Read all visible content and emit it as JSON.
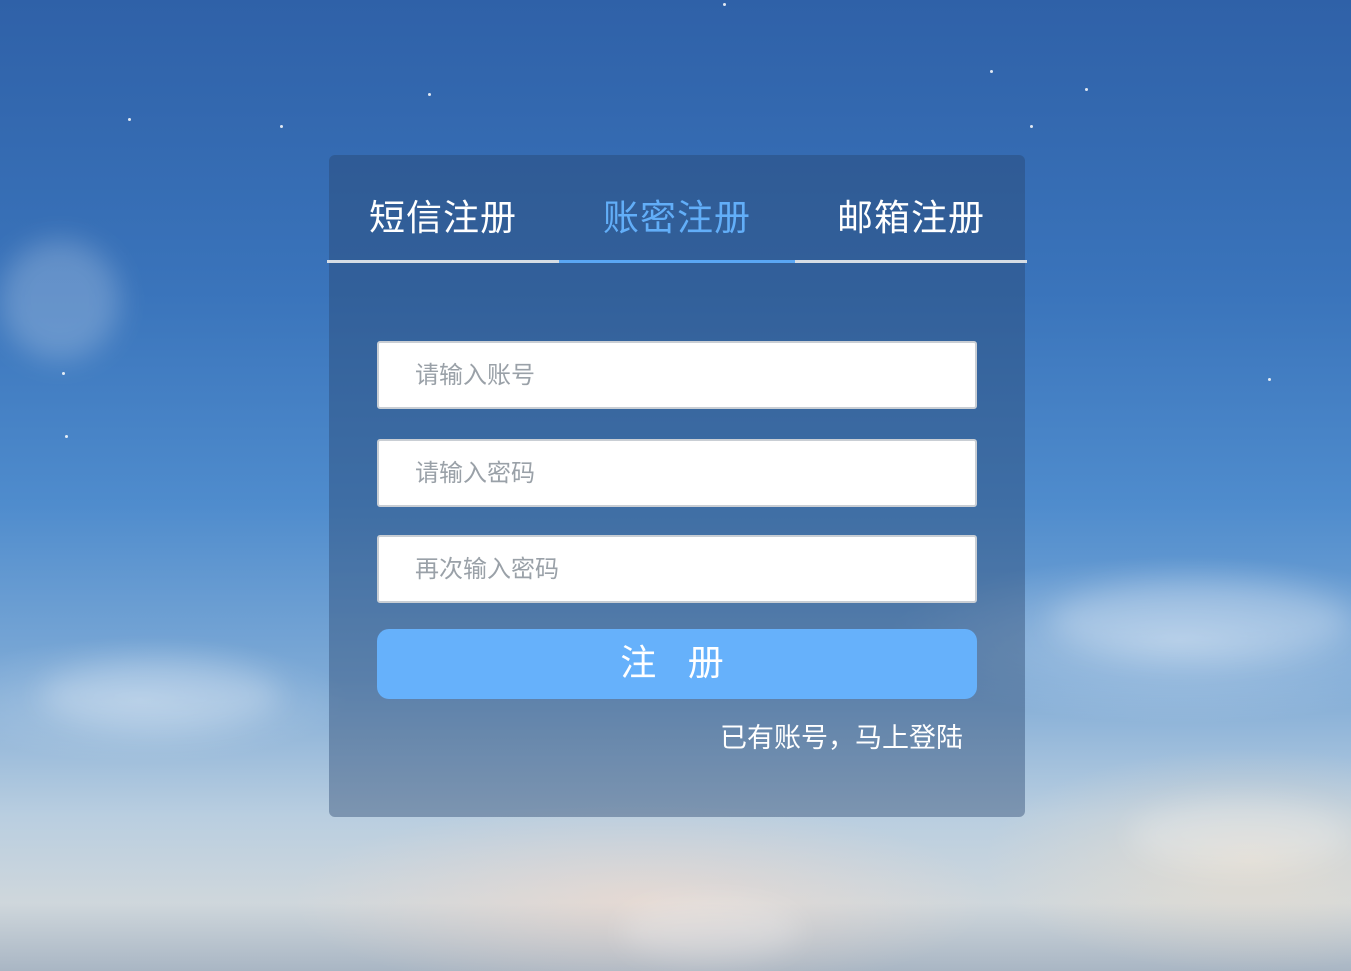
{
  "tabs": [
    {
      "label": "短信注册",
      "active": false
    },
    {
      "label": "账密注册",
      "active": true
    },
    {
      "label": "邮箱注册",
      "active": false
    }
  ],
  "form": {
    "account_placeholder": "请输入账号",
    "password_placeholder": "请输入密码",
    "confirm_placeholder": "再次输入密码",
    "account_value": "",
    "password_value": "",
    "confirm_value": ""
  },
  "submit_label": "注 册",
  "login_link": "已有账号，马上登陆",
  "colors": {
    "accent": "#62aef8",
    "button": "#66b1fb",
    "tab_underline": "#d6dde5",
    "panel": "rgba(40,70,110,0.42)"
  }
}
